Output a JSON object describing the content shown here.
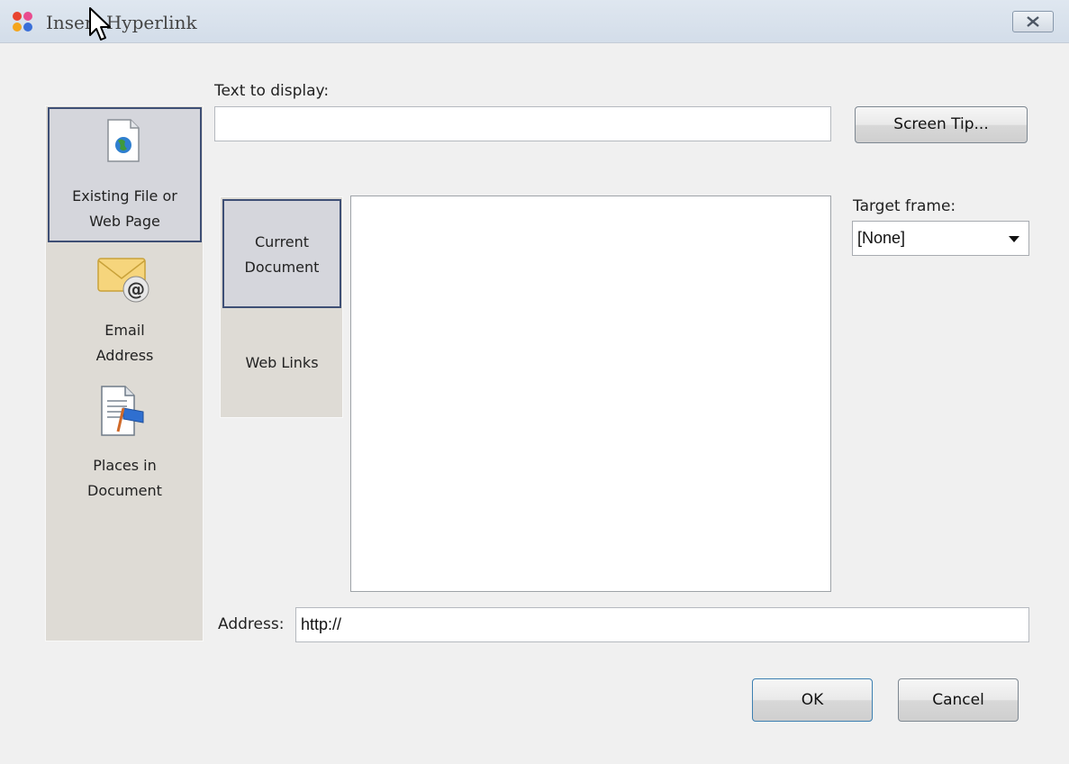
{
  "window": {
    "title": "Insert Hyperlink"
  },
  "colors": {
    "selected_border": "#3e4f75",
    "panel_bg": "#dedbd5",
    "dialog_bg": "#f0f0f0"
  },
  "form": {
    "text_to_display_label": "Text to display:",
    "text_to_display_value": "",
    "screen_tip_button": "Screen Tip...",
    "target_frame_label": "Target frame:",
    "target_frame_value": "[None]",
    "address_label": "Address:",
    "address_value": "http://"
  },
  "link_to": [
    {
      "label": "Existing File or\nWeb Page",
      "icon": "web-page-icon",
      "selected": true
    },
    {
      "label": "Email\nAddress",
      "icon": "email-icon",
      "selected": false
    },
    {
      "label": "Places in\nDocument",
      "icon": "document-place-icon",
      "selected": false
    }
  ],
  "sub_tabs": [
    {
      "label": "Current\nDocument",
      "selected": true
    },
    {
      "label": "Web Links",
      "selected": false
    }
  ],
  "buttons": {
    "ok": "OK",
    "cancel": "Cancel"
  }
}
